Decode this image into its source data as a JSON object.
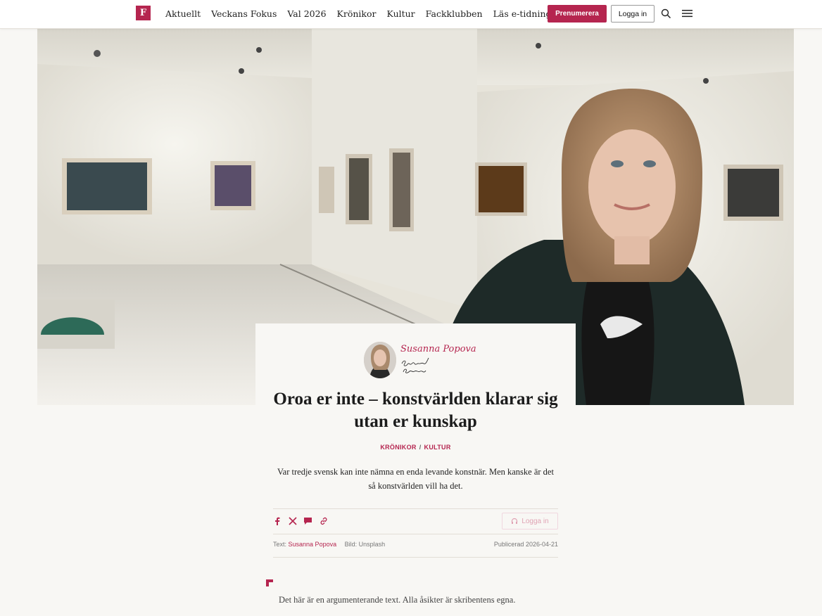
{
  "header": {
    "logo": "F",
    "nav": [
      "Aktuellt",
      "Veckans Fokus",
      "Val 2026",
      "Krönikor",
      "Kultur",
      "Fackklubben",
      "Läs e-tidningen"
    ],
    "subscribe_label": "Prenumerera",
    "login_label": "Logga in",
    "icons": [
      "search-icon",
      "menu-icon"
    ]
  },
  "article": {
    "author": "Susanna Popova",
    "headline": "Oroa er inte – konstvärlden klarar sig utan er kunskap",
    "tags": [
      "KRÖNIKOR",
      "KULTUR"
    ],
    "lead": "Var tredje svensk kan inte nämna en enda levande konstnär. Men kanske är det så konstvärlden vill ha det.",
    "listen_label": "Logga in",
    "share_icons": [
      "facebook-icon",
      "x-icon",
      "comment-icon",
      "link-icon"
    ],
    "meta": {
      "text_label": "Text:",
      "text_author": "Susanna Popova",
      "image_label": "Bild:",
      "image_source": "Unsplash",
      "published_label": "Publicerad",
      "published_date": "2026-04-21"
    },
    "disclaimer": "Det här är en argumenterande text. Alla åsikter är skribentens egna."
  },
  "colors": {
    "accent": "#b5254f",
    "background": "#f8f7f4"
  }
}
